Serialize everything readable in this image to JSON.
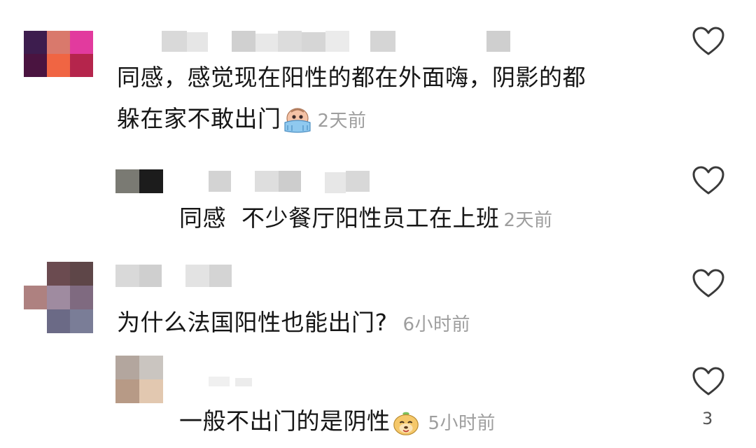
{
  "comments": [
    {
      "text_line1": "同感，感觉现在阳性的都在外面嗨，阴影的都",
      "text_line2": "躲在家不敢出门",
      "time": "2天前",
      "emoji": "crying-face-emoji"
    },
    {
      "text_line1": "同感  不少餐厅阳性员工在上班",
      "time": "2天前"
    },
    {
      "text_line1": "为什么法国阳性也能出门?",
      "time": "6小时前"
    },
    {
      "text_line1": "一般不出门的是阴性",
      "time": "5小时前",
      "emoji": "smiling-face-emoji",
      "like_count": "3"
    }
  ],
  "colors": {
    "time": "#9e9e9e",
    "heart_stroke": "#3a3a3a"
  }
}
